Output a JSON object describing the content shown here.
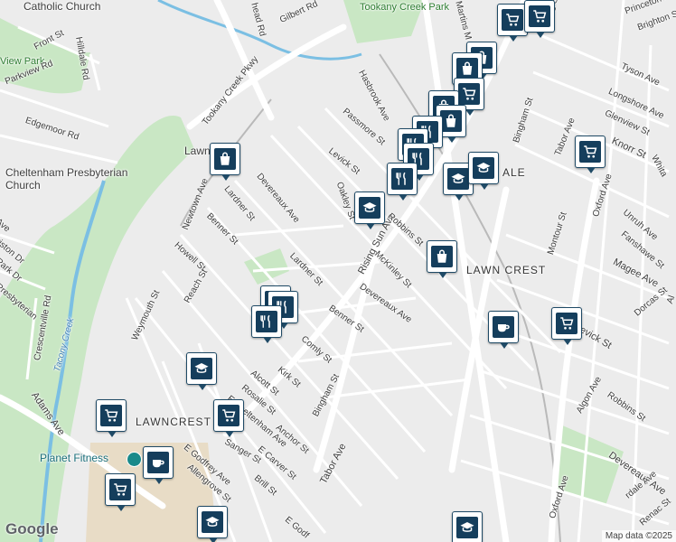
{
  "map": {
    "attribution": "Map data ©2025",
    "logo": "Google",
    "colors": {
      "park": "#c9e7c4",
      "water": "#7bbfe3",
      "road": "#ffffff",
      "major_road": "#ffffff",
      "rail": "#b9b9b9",
      "marker_fill": "#153e5c",
      "poi": "#1a6e7a"
    }
  },
  "labels": {
    "catholic_church": "Catholic Church",
    "tookany_park": "Tookany Creek Park",
    "front_st": "Front St",
    "hilldale_rd": "Hilldale Rd",
    "view_park": "View Park",
    "gilbert_rd": "Gilbert Rd",
    "head_rd": "head Rd",
    "tookany_pkwy": "Tookany Creek Pkwy",
    "parkview_rd": "Parkview Rd",
    "edgemoor_rd": "Edgemoor Rd",
    "cheltenham_church": "Cheltenham Presbyterian Church",
    "lawn": "Lawn",
    "hasbrook_ave": "Hasbrook Ave",
    "passmore_st": "Passmore St",
    "levick_st": "Levick St",
    "oakley_st": "Oakley St",
    "martins_mill": "Martins M",
    "rising_sun_ave": "Rising Sun Ave",
    "rising_sun_ave_2": "Rising Sun Ave",
    "tyson_ave": "Tyson Ave",
    "princeton_ave": "Princeton Ave",
    "brighton_st": "Brighton St",
    "longshore_ave": "Longshore Ave",
    "glenview_st": "Glenview St",
    "knorr_st": "Knorr St",
    "bingham_st": "Bingham St",
    "tabor_ave": "Tabor Ave",
    "oxford_ave": "Oxford Ave",
    "whitaker": "Whita",
    "unruh_ave": "Unruh Ave",
    "fanshawe_st": "Fanshawe St",
    "magee_ave": "Magee Ave",
    "ale": "ALE",
    "devereaux_ave": "Devereaux Ave",
    "lardner_st": "Lardner St",
    "newtown_ave": "Newtown Ave",
    "benner_st": "Benner St",
    "howell_st": "Howell St",
    "reach_st": "Reach St",
    "weymouth_st": "Weymouth St",
    "robbins_st": "Robbins St",
    "mckinley_st": "McKinley St",
    "lawn_crest": "LAWN CREST",
    "montour_st": "Montour St",
    "lardner_st_2": "Lardner St",
    "devereaux_ave_2": "Devereaux Ave",
    "benner_st_2": "Benner St",
    "comly_st": "Comly St",
    "kirk_st": "Kirk St",
    "alcott_st": "Alcott St",
    "rosalie_st": "Rosalie St",
    "cheltenham_ave": "E Cheltenham Ave",
    "anchor_st": "Anchor St",
    "carver_st": "E Carver St",
    "bingham_st_2": "Bingham St",
    "tabor_ave_2": "Tabor Ave",
    "brill_st": "Brill St",
    "godfrey_ave": "E Godfrey Ave",
    "allengrove_st": "Allengrove St",
    "sanger_st": "Sanger St",
    "lawncrest": "LAWNCREST",
    "planet_fitness": "Planet Fitness",
    "adams_ave": "Adams Ave",
    "tacony_creek": "Tacony Creek",
    "crescentville_rd": "Crescentville Rd",
    "ave_left": "Ave",
    "ariston_dr": "riston Dr",
    "park_dr": "Park Dr",
    "presbyterian": "Presbyterian",
    "dorcas_st": "Dorcas St",
    "levick_st_2": "Levick St",
    "algon_ave": "Algon Ave",
    "robbins_st_2": "Robbins St",
    "devereaux_ave_3": "Devereaux Ave",
    "oxford_ave_2": "Oxford Ave",
    "ardale_ave": "rdale Ave",
    "renac_st": "Renac St",
    "godfrey_bottom": "E Godf",
    "al": "Al"
  },
  "markers": [
    {
      "type": "grocery",
      "icon": "shopping-cart-icon"
    },
    {
      "type": "grocery",
      "icon": "shopping-cart-icon"
    },
    {
      "type": "shopping",
      "icon": "shopping-bag-icon"
    },
    {
      "type": "shopping",
      "icon": "shopping-bag-icon"
    },
    {
      "type": "grocery",
      "icon": "shopping-cart-icon"
    },
    {
      "type": "shopping",
      "icon": "shopping-bag-icon"
    },
    {
      "type": "shopping",
      "icon": "shopping-bag-icon"
    },
    {
      "type": "restaurant",
      "icon": "restaurant-icon"
    },
    {
      "type": "restaurant",
      "icon": "restaurant-icon"
    },
    {
      "type": "restaurant",
      "icon": "restaurant-icon"
    },
    {
      "type": "school",
      "icon": "school-icon"
    },
    {
      "type": "school",
      "icon": "school-icon"
    },
    {
      "type": "restaurant",
      "icon": "restaurant-icon"
    },
    {
      "type": "school",
      "icon": "school-icon"
    },
    {
      "type": "shopping",
      "icon": "shopping-bag-icon"
    },
    {
      "type": "grocery",
      "icon": "shopping-cart-icon"
    },
    {
      "type": "shopping",
      "icon": "shopping-bag-icon"
    },
    {
      "type": "restaurant",
      "icon": "restaurant-icon"
    },
    {
      "type": "restaurant",
      "icon": "restaurant-icon"
    },
    {
      "type": "restaurant",
      "icon": "restaurant-icon"
    },
    {
      "type": "cafe",
      "icon": "coffee-icon"
    },
    {
      "type": "grocery",
      "icon": "shopping-cart-icon"
    },
    {
      "type": "school",
      "icon": "school-icon"
    },
    {
      "type": "grocery",
      "icon": "shopping-cart-icon"
    },
    {
      "type": "grocery",
      "icon": "shopping-cart-icon"
    },
    {
      "type": "cafe",
      "icon": "coffee-icon"
    },
    {
      "type": "grocery",
      "icon": "shopping-cart-icon"
    },
    {
      "type": "school",
      "icon": "school-icon"
    },
    {
      "type": "school",
      "icon": "school-icon"
    }
  ]
}
